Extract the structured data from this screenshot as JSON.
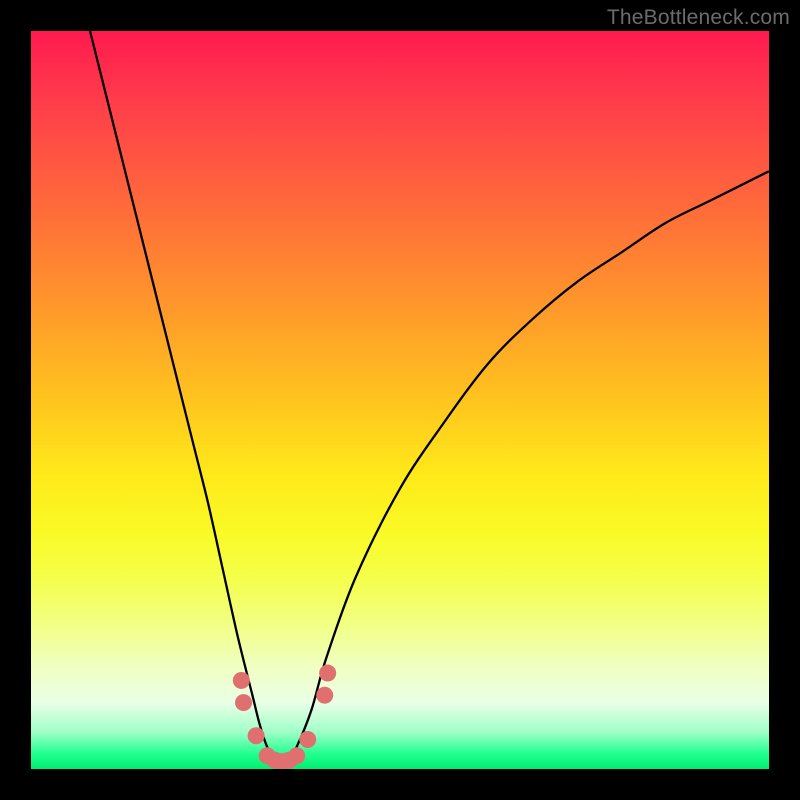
{
  "watermark": "TheBottleneck.com",
  "colors": {
    "frame": "#000000",
    "curve": "#000000",
    "marker_fill": "#e07070",
    "marker_stroke": "#c85858",
    "gradient_top": "#ff1a4f",
    "gradient_bottom": "#00f070"
  },
  "chart_data": {
    "type": "line",
    "title": "",
    "xlabel": "",
    "ylabel": "",
    "xlim": [
      0,
      100
    ],
    "ylim": [
      0,
      100
    ],
    "grid": false,
    "legend": false,
    "series": [
      {
        "name": "curve",
        "x": [
          8,
          10,
          12,
          14,
          16,
          18,
          20,
          22,
          24,
          26,
          28,
          30,
          31,
          32,
          33,
          34,
          35,
          36,
          38,
          40,
          44,
          50,
          56,
          62,
          68,
          74,
          80,
          86,
          92,
          100
        ],
        "y": [
          100,
          92,
          84,
          76,
          68,
          60,
          52,
          44,
          36,
          27,
          18,
          10,
          6,
          3,
          1.5,
          1,
          1.5,
          3,
          8,
          15,
          26,
          38,
          47,
          55,
          61,
          66,
          70,
          74,
          77,
          81
        ]
      }
    ],
    "markers": {
      "name": "highlight-points",
      "x": [
        28.5,
        28.8,
        30.5,
        32,
        33,
        34,
        35,
        36,
        37.5,
        39.8,
        40.2
      ],
      "y": [
        12,
        9,
        4.5,
        1.8,
        1.2,
        1,
        1.2,
        1.8,
        4,
        10,
        13
      ]
    }
  }
}
